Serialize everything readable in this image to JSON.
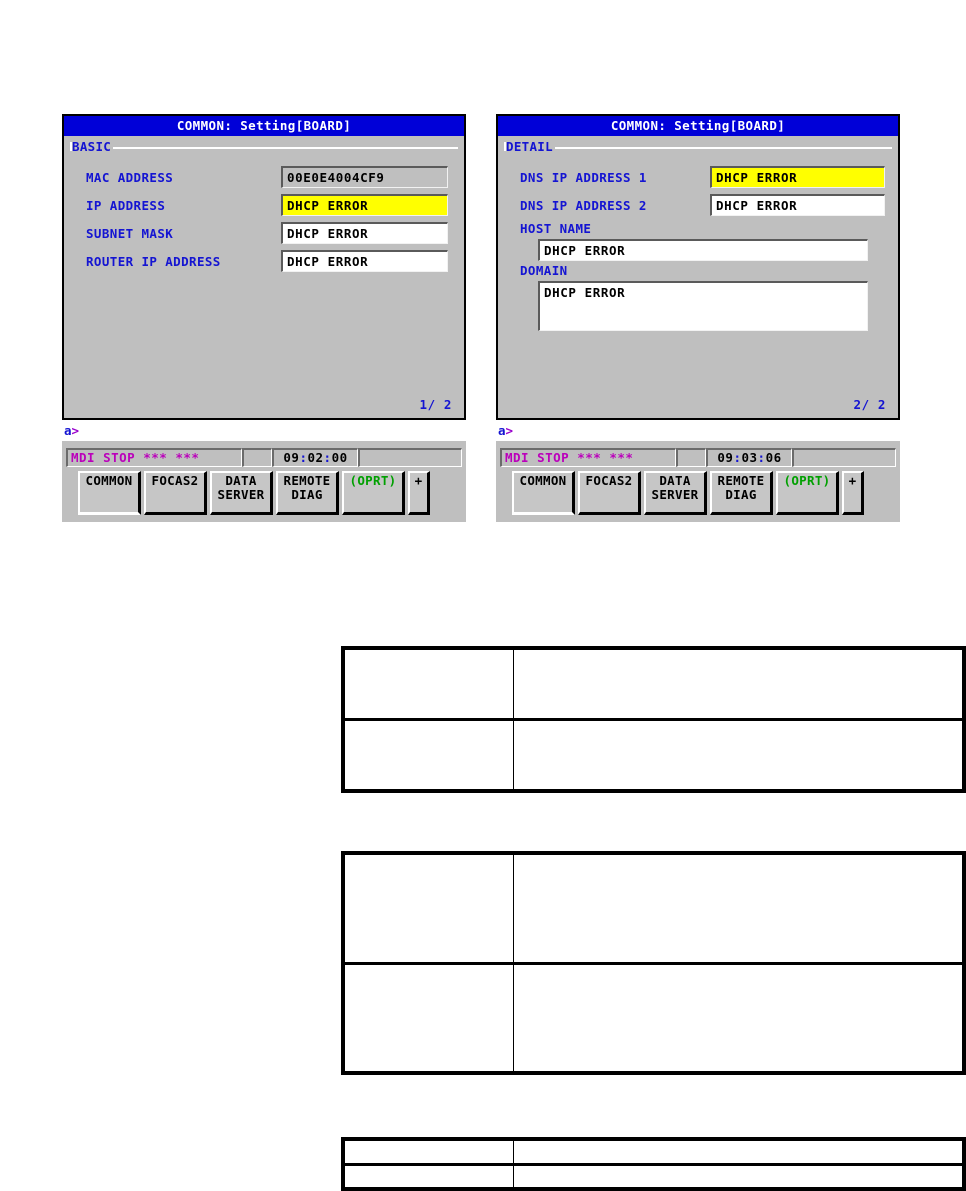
{
  "screens": [
    {
      "id": "basic",
      "title": "COMMON: Setting[BOARD]",
      "group_label": "BASIC",
      "fields": [
        {
          "label": "MAC ADDRESS",
          "value": "00E0E4004CF9",
          "style": "readonly"
        },
        {
          "label": "IP ADDRESS",
          "value": "DHCP ERROR",
          "style": "highlight"
        },
        {
          "label": "SUBNET MASK",
          "value": "DHCP ERROR",
          "style": "normal"
        },
        {
          "label": "ROUTER IP ADDRESS",
          "value": "DHCP ERROR",
          "style": "normal"
        }
      ],
      "page_indicator": "1/ 2",
      "prompt": {
        "text": "a",
        "caret": ">"
      },
      "status": {
        "mode": "MDI  STOP *** ***",
        "time_h": "09",
        "time_m": "02",
        "time_s": "00"
      }
    },
    {
      "id": "detail",
      "title": "COMMON: Setting[BOARD]",
      "group_label": "DETAIL",
      "fields": [
        {
          "label": "DNS IP ADDRESS 1",
          "value": "DHCP ERROR",
          "style": "highlight"
        },
        {
          "label": "DNS IP ADDRESS 2",
          "value": "DHCP ERROR",
          "style": "normal"
        }
      ],
      "fullboxes": [
        {
          "label": "HOST NAME",
          "value": "DHCP ERROR",
          "size": "h1"
        },
        {
          "label": "DOMAIN",
          "value": "DHCP ERROR",
          "size": "h2"
        }
      ],
      "page_indicator": "2/ 2",
      "prompt": {
        "text": "a",
        "caret": ">"
      },
      "status": {
        "mode": "MDI  STOP *** ***",
        "time_h": "09",
        "time_m": "03",
        "time_s": "06"
      }
    }
  ],
  "softkeys": [
    {
      "label": "COMMON",
      "kind": "selected"
    },
    {
      "label": "FOCAS2",
      "kind": "normal"
    },
    {
      "label": "DATA\nSERVER",
      "kind": "normal"
    },
    {
      "label": "REMOTE\nDIAG",
      "kind": "normal"
    },
    {
      "label": "(OPRT)",
      "kind": "oprt"
    },
    {
      "label": "+",
      "kind": "plus"
    }
  ],
  "doc_tables": [
    {
      "id": "table-1",
      "rows": [
        {
          "type": "head",
          "cells": [
            "",
            ""
          ]
        },
        {
          "type": "body",
          "cells": [
            "",
            ""
          ]
        }
      ]
    },
    {
      "id": "table-2",
      "rows": [
        {
          "type": "head",
          "cells": [
            "",
            ""
          ]
        },
        {
          "type": "body",
          "cells": [
            "",
            ""
          ]
        }
      ]
    },
    {
      "id": "table-3",
      "rows": [
        {
          "type": "head",
          "cells": [
            "",
            ""
          ]
        },
        {
          "type": "body",
          "cells": [
            "",
            ""
          ]
        }
      ]
    }
  ],
  "colors": {
    "title_bar": "#0000d8",
    "label_blue": "#1414d2",
    "highlight_yellow": "#ffff00",
    "screen_gray": "#bfbfbf",
    "status_magenta": "#bb00bb",
    "oprt_green": "#00a000",
    "prompt_purple": "#9900cc"
  }
}
